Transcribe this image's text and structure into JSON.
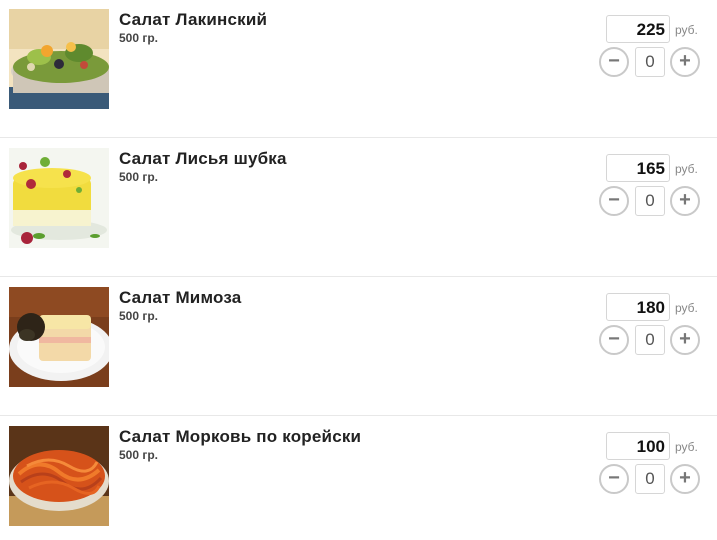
{
  "currency_label": "руб.",
  "items": [
    {
      "name": "Салат Лакинский",
      "weight": "500 гр.",
      "price": "225",
      "quantity": "0",
      "minus_label": "−",
      "plus_label": "+"
    },
    {
      "name": "Салат Лисья шубка",
      "weight": "500 гр.",
      "price": "165",
      "quantity": "0",
      "minus_label": "−",
      "plus_label": "+"
    },
    {
      "name": "Салат Мимоза",
      "weight": "500 гр.",
      "price": "180",
      "quantity": "0",
      "minus_label": "−",
      "plus_label": "+"
    },
    {
      "name": "Салат Морковь по корейски",
      "weight": "500 гр.",
      "price": "100",
      "quantity": "0",
      "minus_label": "−",
      "plus_label": "+"
    }
  ]
}
